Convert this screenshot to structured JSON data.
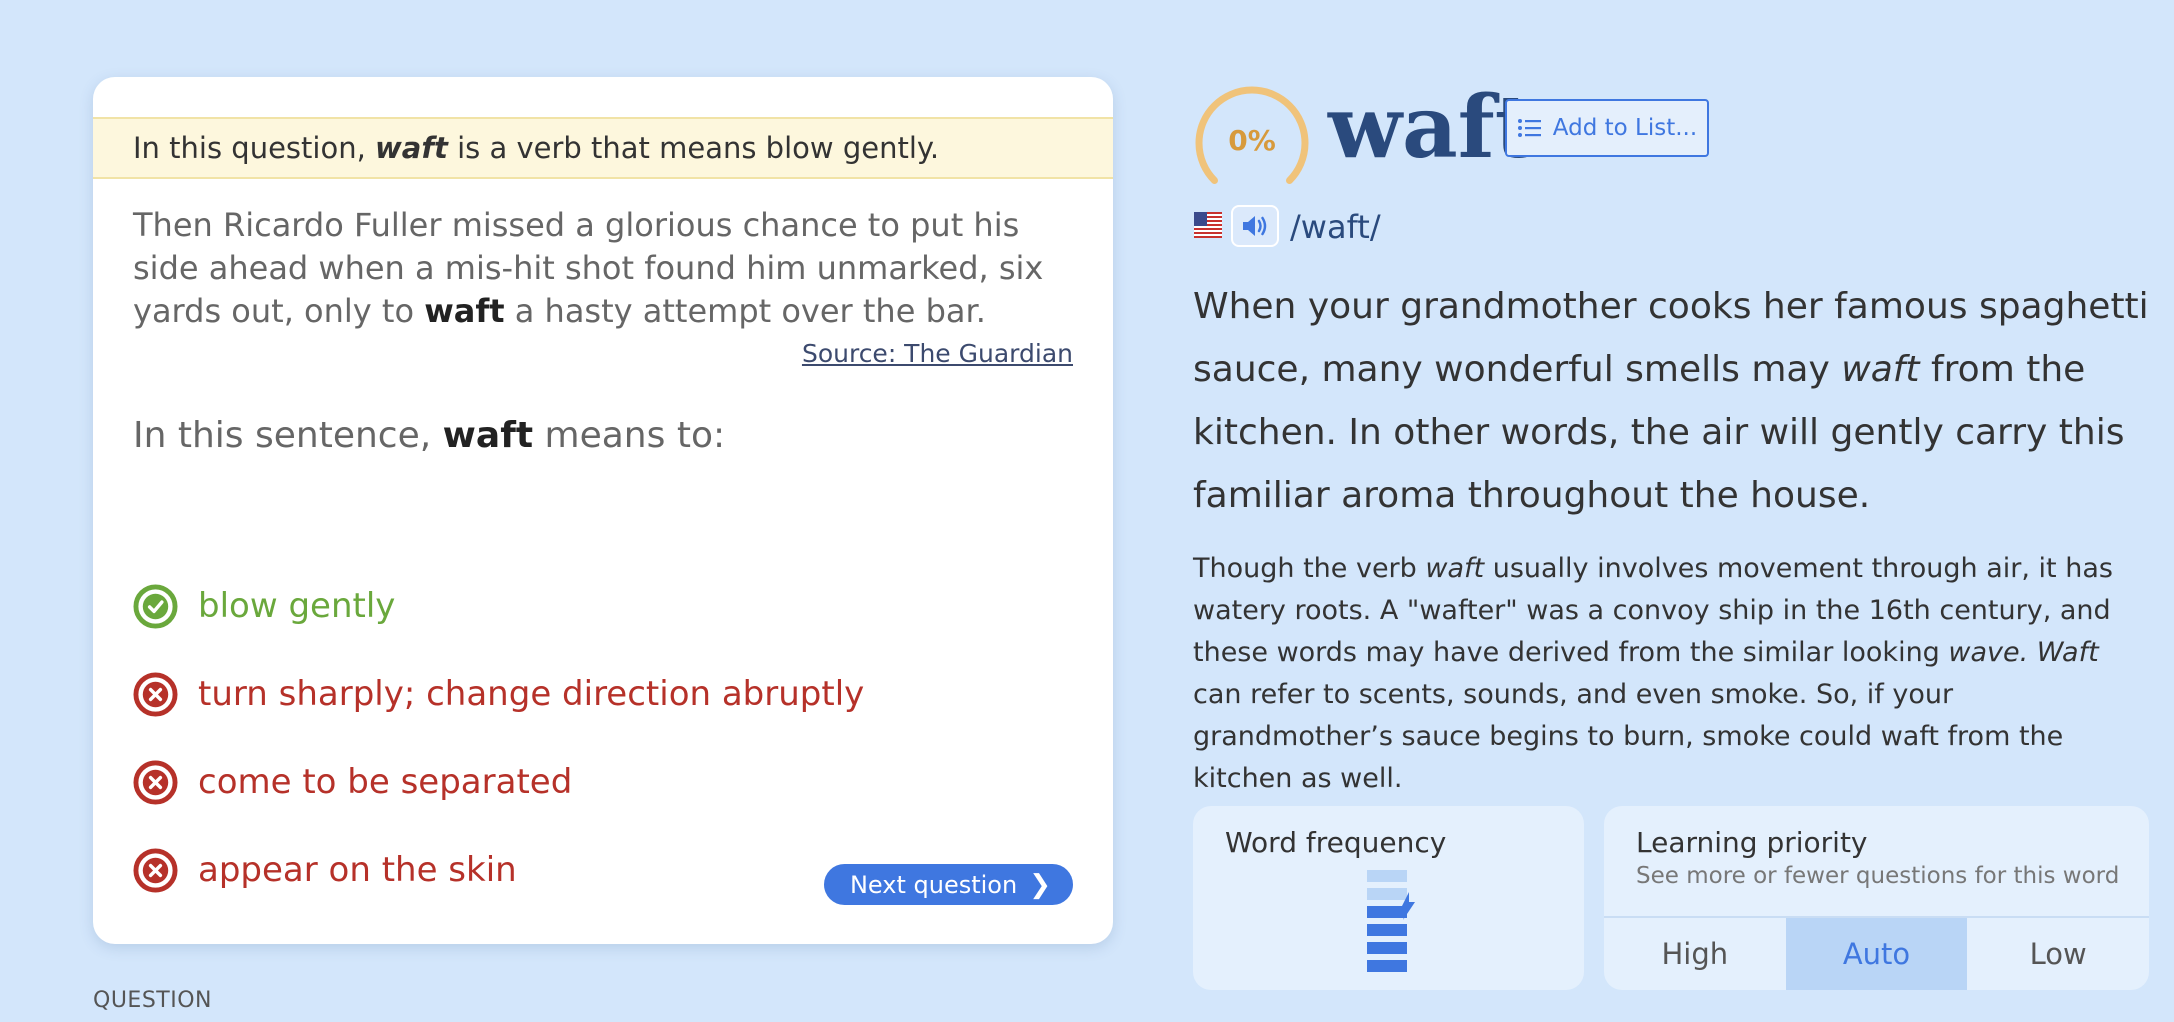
{
  "question": {
    "hint": {
      "prefix": "In this question,",
      "word": "waft",
      "suffix": "is a verb that means blow gently."
    },
    "sentence": {
      "before": "Then Ricardo Fuller missed a glorious chance to put his side ahead when a mis-hit shot found him unmarked, six yards out, only to",
      "word": "waft",
      "after": "a hasty attempt over the bar."
    },
    "source": "Source: The Guardian",
    "prompt": {
      "before": "In this sentence,",
      "word": "waft",
      "after": "means to:"
    },
    "answers": [
      {
        "text": "blow gently",
        "status": "correct"
      },
      {
        "text": "turn sharply; change direction abruptly",
        "status": "wrong"
      },
      {
        "text": "come to be separated",
        "status": "wrong"
      },
      {
        "text": "appear on the skin",
        "status": "wrong"
      }
    ],
    "next_label": "Next question",
    "section_label": "QUESTION"
  },
  "word_panel": {
    "progress": "0%",
    "progress_value": 0,
    "word": "waft",
    "add_to_list_label": "Add to List...",
    "pronunciation": "/waft/",
    "short_definition": {
      "part1": "When your grandmother cooks her famous spaghetti sauce, many wonderful smells may",
      "word": "waft",
      "part2": "from the kitchen. In other words, the air will gently carry this familiar aroma throughout the house."
    },
    "long_definition": {
      "part1": "Though the verb",
      "word": "waft",
      "part2": "usually involves movement through air, it has watery roots. A \"wafter\" was a convoy ship in the 16th century, and these words may have derived from the similar looking",
      "em2": "wave. Waft",
      "part3": "can refer to scents, sounds, and even smoke. So, if your grandmother’s sauce begins to burn, smoke could waft from the kitchen as well."
    },
    "word_frequency_label": "Word frequency",
    "learning_priority": {
      "title": "Learning priority",
      "subtitle": "See more or fewer questions for this word",
      "options": [
        "High",
        "Auto",
        "Low"
      ],
      "selected": "Auto"
    }
  },
  "colors": {
    "background": "#d3e6fb",
    "correct": "#6aa83c",
    "wrong": "#b63129",
    "accent": "#3f77e0",
    "progress": "#d79a3c",
    "word": "#2a4a7d"
  }
}
